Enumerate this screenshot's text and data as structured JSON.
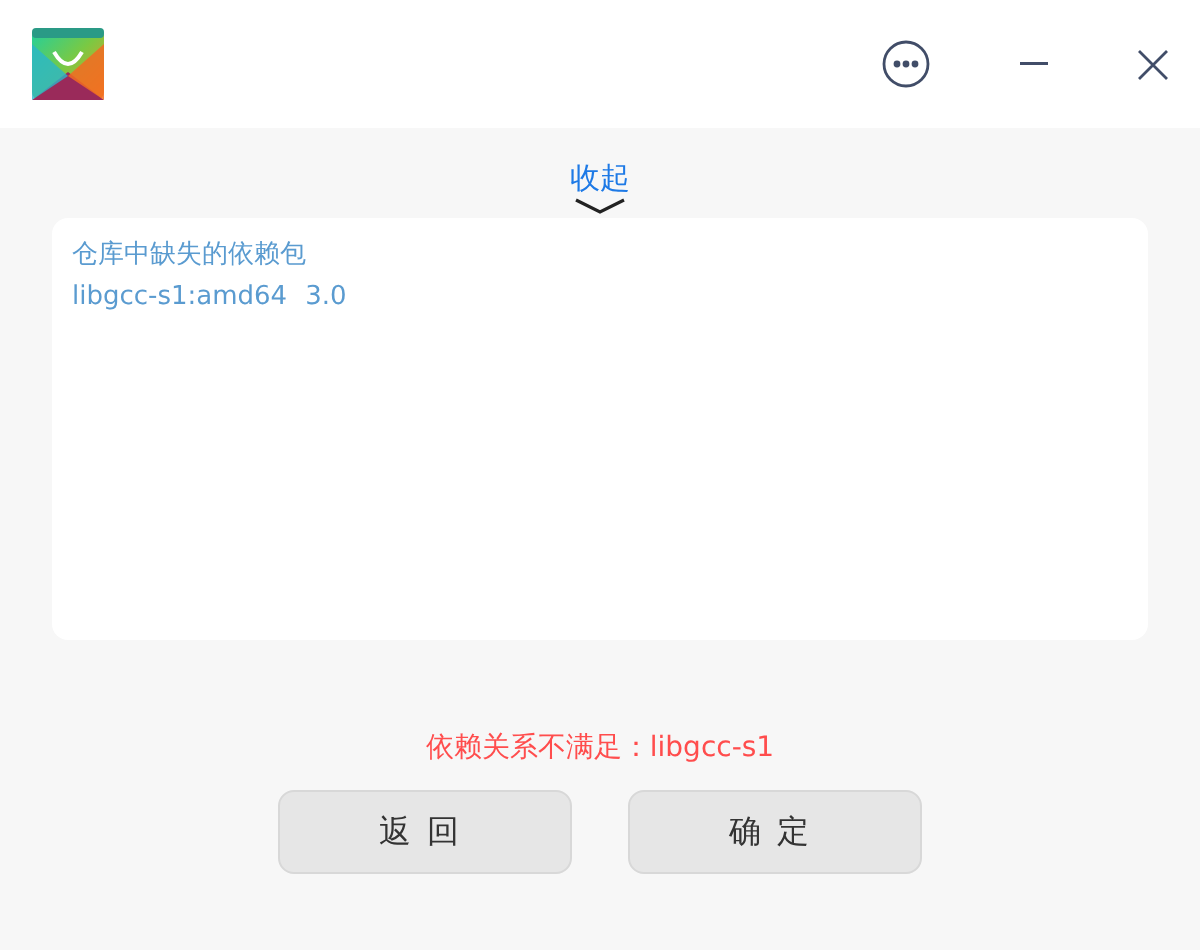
{
  "title_bar": {
    "buttons": [
      {
        "kind": "more"
      },
      {
        "kind": "minimize"
      },
      {
        "kind": "close"
      }
    ]
  },
  "collapse_link": "收起",
  "missing_panel": {
    "heading": "仓库中缺失的依赖包",
    "packages": [
      {
        "name": "libgcc-s1:amd64",
        "version": "3.0"
      }
    ]
  },
  "error_message": "依赖关系不满足：libgcc-s1",
  "buttons": [
    "返回",
    "确定"
  ]
}
